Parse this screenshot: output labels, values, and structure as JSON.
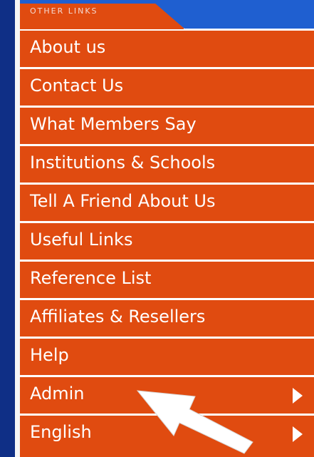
{
  "header": {
    "title": "OTHER LINKS"
  },
  "menu": {
    "items": [
      {
        "label": "About us",
        "has_submenu": false
      },
      {
        "label": "Contact Us",
        "has_submenu": false
      },
      {
        "label": "What Members Say",
        "has_submenu": false
      },
      {
        "label": "Institutions  &  Schools",
        "has_submenu": false
      },
      {
        "label": "Tell A Friend About Us",
        "has_submenu": false
      },
      {
        "label": "Useful Links",
        "has_submenu": false
      },
      {
        "label": "Reference List",
        "has_submenu": false
      },
      {
        "label": "Affiliates & Resellers",
        "has_submenu": false
      },
      {
        "label": "Help",
        "has_submenu": false
      },
      {
        "label": "Admin",
        "has_submenu": true
      },
      {
        "label": "English",
        "has_submenu": true
      }
    ]
  },
  "colors": {
    "menu_background": "#e04b10",
    "left_bar": "#0f2f86",
    "header_strip": "#1f5fd0",
    "text": "#ffffff"
  },
  "icons": {
    "submenu": "chevron-right-icon",
    "pointer": "arrow-cursor-icon"
  }
}
